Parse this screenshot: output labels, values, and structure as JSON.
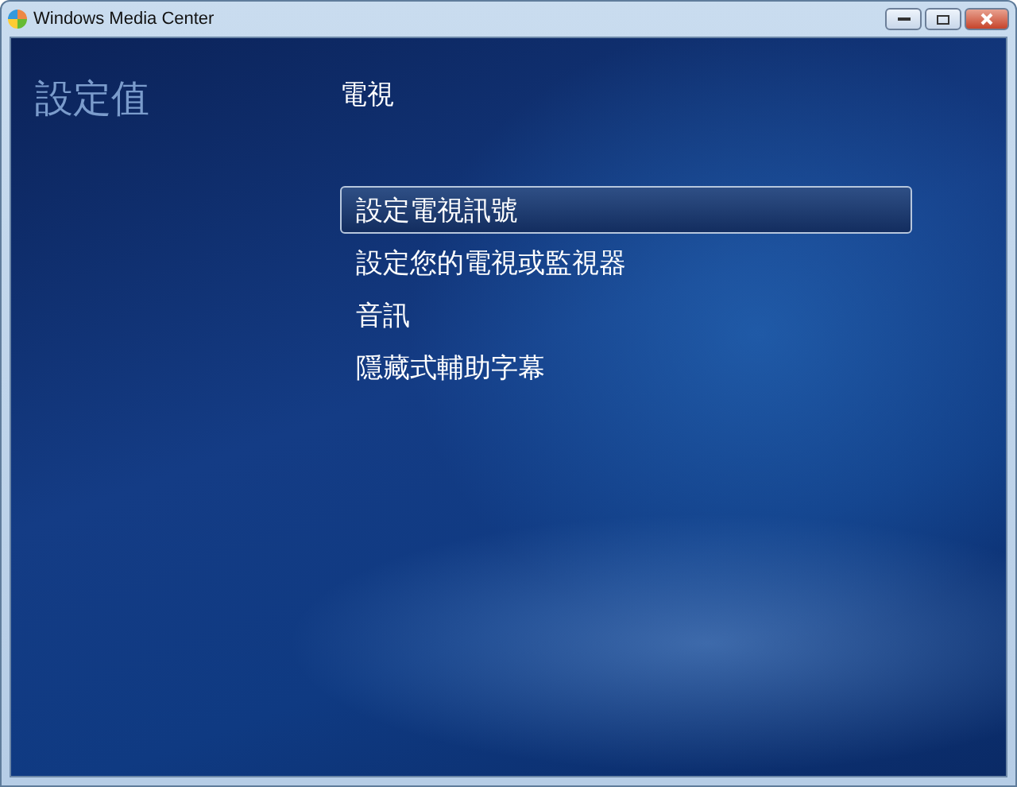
{
  "window": {
    "title": "Windows Media Center"
  },
  "section_title": "設定值",
  "page_title": "電視",
  "menu": [
    {
      "label": "設定電視訊號",
      "selected": true
    },
    {
      "label": "設定您的電視或監視器",
      "selected": false
    },
    {
      "label": "音訊",
      "selected": false
    },
    {
      "label": "隱藏式輔助字幕",
      "selected": false
    }
  ]
}
